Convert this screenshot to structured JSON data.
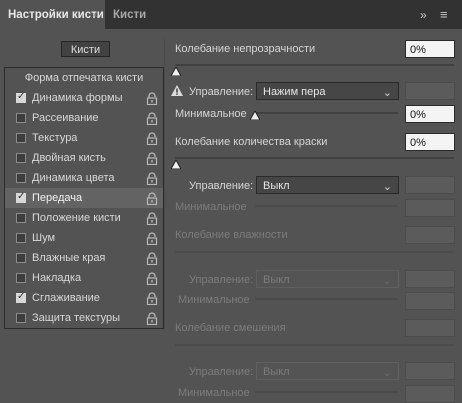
{
  "tabs": {
    "active_label": "Настройки кисти",
    "inactive_label": "Кисти",
    "close_glyph": "×",
    "collapse_glyph": "»",
    "menu_glyph": "≡"
  },
  "brushes_button": "Кисти",
  "left_panel": {
    "header": "Форма отпечатка кисти",
    "items": [
      {
        "label": "Динамика формы",
        "checked": true,
        "selected": false
      },
      {
        "label": "Рассеивание",
        "checked": false,
        "selected": false
      },
      {
        "label": "Текстура",
        "checked": false,
        "selected": false
      },
      {
        "label": "Двойная кисть",
        "checked": false,
        "selected": false
      },
      {
        "label": "Динамика цвета",
        "checked": false,
        "selected": false
      },
      {
        "label": "Передача",
        "checked": true,
        "selected": true
      },
      {
        "label": "Положение кисти",
        "checked": false,
        "selected": false
      },
      {
        "label": "Шум",
        "checked": false,
        "selected": false
      },
      {
        "label": "Влажные края",
        "checked": false,
        "selected": false
      },
      {
        "label": "Накладка",
        "checked": false,
        "selected": false
      },
      {
        "label": "Сглаживание",
        "checked": true,
        "selected": false
      },
      {
        "label": "Защита текстуры",
        "checked": false,
        "selected": false
      }
    ]
  },
  "settings": {
    "opacity_jitter": {
      "label": "Колебание непрозрачности",
      "value": "0%",
      "control_label": "Управление:",
      "control_value": "Нажим пера",
      "minimum_label": "Минимальное",
      "minimum_value": "0%"
    },
    "flow_jitter": {
      "label": "Колебание количества краски",
      "value": "0%",
      "control_label": "Управление:",
      "control_value": "Выкл",
      "minimum_label": "Минимальное"
    },
    "wetness_jitter": {
      "label": "Колебание влажности",
      "control_label": "Управление:",
      "control_value": "Выкл",
      "minimum_label": "Минимальное"
    },
    "mix_jitter": {
      "label": "Колебание смешения",
      "control_label": "Управление:",
      "control_value": "Выкл",
      "minimum_label": "Минимальное"
    }
  },
  "icons": {
    "lock": "lock-icon",
    "warning": "warning-icon",
    "dropdown": "chevron-down-icon",
    "checkbox_on": "checkmark-icon"
  }
}
